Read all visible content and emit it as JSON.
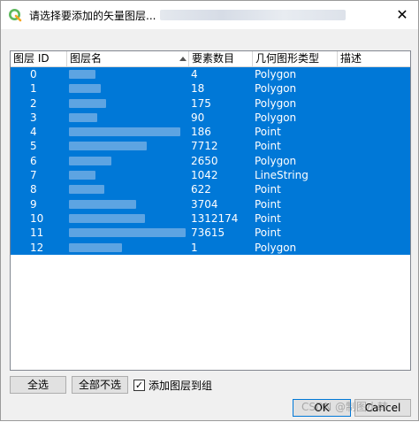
{
  "window": {
    "title": "请选择要添加的矢量图层..."
  },
  "table": {
    "columns": [
      "图层 ID",
      "图层名",
      "要素数目",
      "几何图形类型",
      "描述"
    ],
    "rows": [
      {
        "id": "0",
        "count": "4",
        "geom": "Polygon"
      },
      {
        "id": "1",
        "count": "18",
        "geom": "Polygon"
      },
      {
        "id": "2",
        "count": "175",
        "geom": "Polygon"
      },
      {
        "id": "3",
        "count": "90",
        "geom": "Polygon"
      },
      {
        "id": "4",
        "count": "186",
        "geom": "Point"
      },
      {
        "id": "5",
        "count": "7712",
        "geom": "Point"
      },
      {
        "id": "6",
        "count": "2650",
        "geom": "Polygon"
      },
      {
        "id": "7",
        "count": "1042",
        "geom": "LineString"
      },
      {
        "id": "8",
        "count": "622",
        "geom": "Point"
      },
      {
        "id": "9",
        "count": "3704",
        "geom": "Point"
      },
      {
        "id": "10",
        "count": "1312174",
        "geom": "Point"
      },
      {
        "id": "11",
        "count": "73615",
        "geom": "Point"
      },
      {
        "id": "12",
        "count": "1",
        "geom": "Polygon"
      }
    ]
  },
  "footer": {
    "select_all_label": "全选",
    "deselect_all_label": "全部不选",
    "add_to_group_label": "添加图层到组",
    "add_to_group_checked": true,
    "ok_label": "OK",
    "cancel_label": "Cancel",
    "watermark": "CSDN @制图小韩"
  },
  "colors": {
    "selection": "#0078d7",
    "app_icon": "#5cb85c"
  },
  "icons": {
    "app": "qgis-icon",
    "close": "close-icon",
    "sort": "sort-ascending-icon",
    "check": "checkmark-icon"
  }
}
